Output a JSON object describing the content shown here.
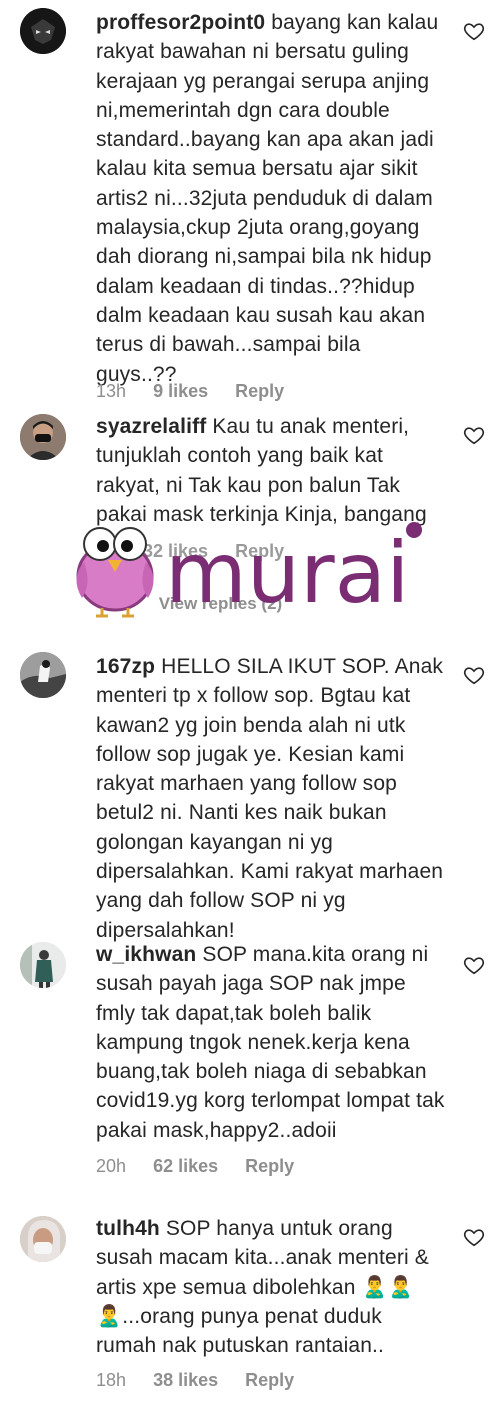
{
  "comments": [
    {
      "username": "proffesor2point0",
      "text": "bayang kan kalau rakyat bawahan ni bersatu guling kerajaan yg perangai serupa anjing ni,memerintah dgn cara double standard..bayang kan apa akan jadi kalau kita semua bersatu ajar sikit artis2 ni...32juta penduduk di dalam malaysia,ckup 2juta orang,goyang dah diorang ni,sampai bila nk hidup dalam keadaan di tindas..??hidup dalm keadaan kau susah kau akan terus di bawah...sampai bila guys..??",
      "time": "13h",
      "likes": "9 likes",
      "reply": "Reply"
    },
    {
      "username": "syazrelaliff",
      "text": "Kau tu anak menteri, tunjuklah contoh yang baik kat rakyat, ni Tak kau pon balun Tak pakai mask terkinja Kinja, bangang",
      "time": "",
      "likes": "32 likes",
      "reply": "Reply",
      "view_replies": "View replies (2)"
    },
    {
      "username": "167zp",
      "text": "HELLO SILA IKUT SOP. Anak menteri tp x follow sop. Bgtau kat kawan2 yg join benda alah ni utk follow sop jugak ye. Kesian kami rakyat marhaen yang follow sop betul2 ni. Nanti kes naik bukan golongan kayangan ni yg dipersalahkan. Kami rakyat marhaen yang dah follow SOP ni yg dipersalahkan!"
    },
    {
      "username": "w_ikhwan",
      "text": "SOP mana.kita orang ni susah payah jaga SOP nak jmpe fmly tak dapat,tak boleh balik kampung tngok nenek.kerja kena buang,tak boleh niaga di sebabkan covid19.yg korg terlompat lompat tak pakai mask,happy2..adoii",
      "time": "20h",
      "likes": "62 likes",
      "reply": "Reply"
    },
    {
      "username": "tulh4h",
      "text": "SOP hanya untuk orang susah macam kita...anak menteri & artis xpe semua dibolehkan 🙎‍♂️🙎‍♂️🙎‍♂️...orang punya penat duduk rumah nak putuskan rantaian..",
      "time": "18h",
      "likes": "38 likes",
      "reply": "Reply"
    }
  ],
  "watermark": {
    "text": "murai",
    "color": "#7b2d73"
  }
}
